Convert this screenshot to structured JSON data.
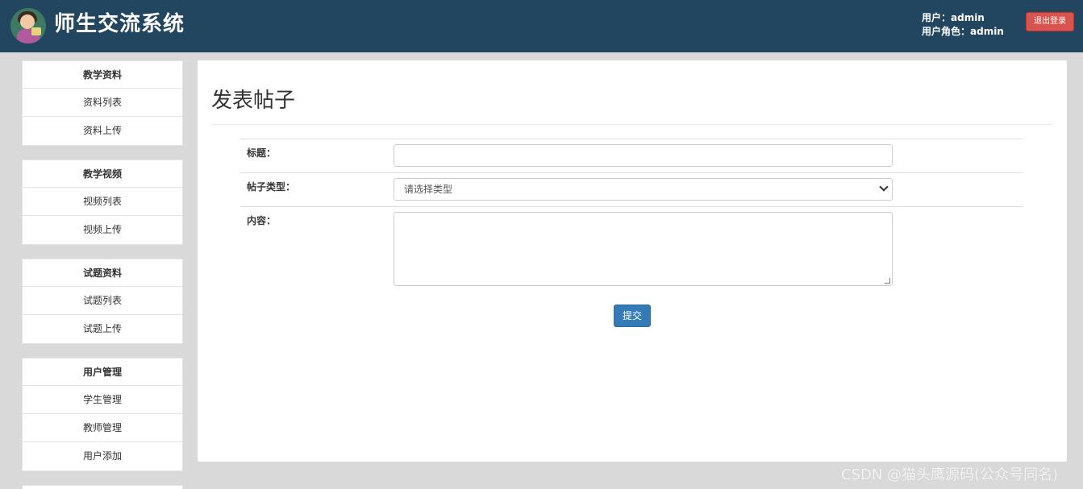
{
  "header": {
    "title": "师生交流系统",
    "user_line": "用户：admin",
    "role_line": "用户角色：admin",
    "logout_label": "退出登录",
    "colors": {
      "bar": "#22465f",
      "logout": "#d9534f"
    }
  },
  "sidebar": {
    "groups": [
      {
        "title": "教学资料",
        "items": [
          "资料列表",
          "资料上传"
        ]
      },
      {
        "title": "教学视频",
        "items": [
          "视频列表",
          "视频上传"
        ]
      },
      {
        "title": "试题资料",
        "items": [
          "试题列表",
          "试题上传"
        ]
      },
      {
        "title": "用户管理",
        "items": [
          "学生管理",
          "教师管理",
          "用户添加"
        ]
      }
    ]
  },
  "main": {
    "page_title": "发表帖子",
    "form": {
      "title_label": "标题：",
      "title_value": "",
      "type_label": "帖子类型：",
      "type_selected": "请选择类型",
      "content_label": "内容：",
      "content_value": "",
      "submit_label": "提交"
    }
  },
  "watermark": "CSDN @猫头鹰源码(公众号同名)",
  "icons": {
    "logo": "teacher-avatar-logo",
    "select": "chevron-down-icon"
  }
}
